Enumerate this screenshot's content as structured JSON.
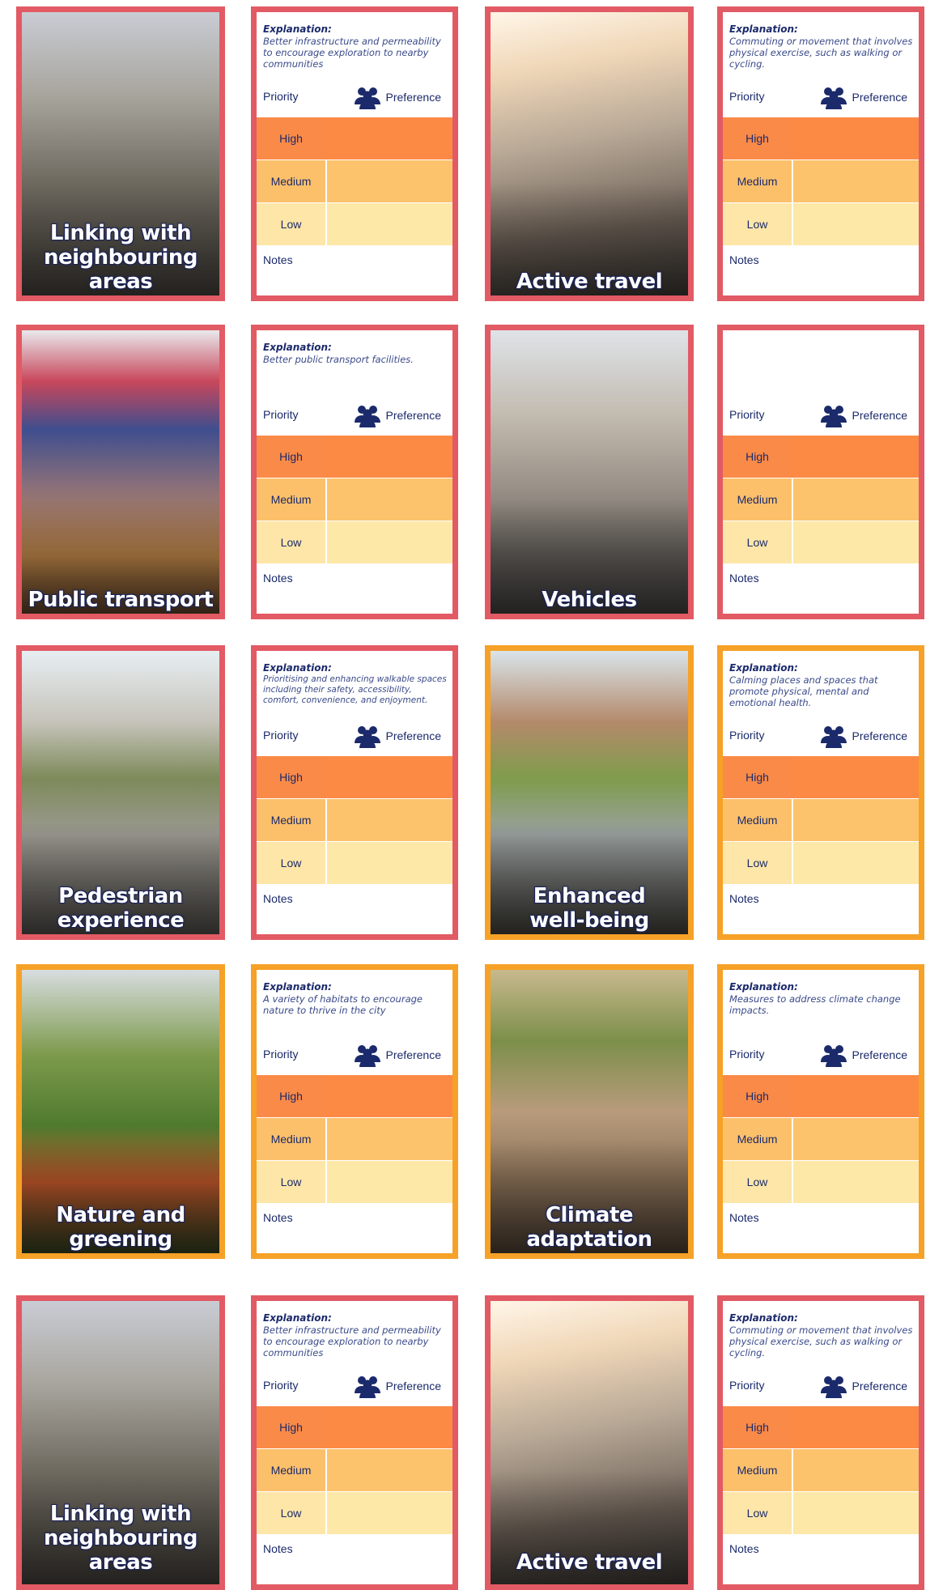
{
  "common": {
    "explanation_label": "Explanation:",
    "priority_label": "Priority",
    "preference_label": "Preference",
    "levels": {
      "high": "High",
      "medium": "Medium",
      "low": "Low"
    },
    "notes_label": "Notes"
  },
  "colors": {
    "red_border": "#e25a64",
    "orange_border": "#f6a127",
    "high": "#fb8a45",
    "medium": "#fdc26c",
    "low": "#fde8a8",
    "navy": "#1b2a6b"
  },
  "photos": [
    {
      "title": "Linking with\nneighbouring areas"
    },
    {
      "title": "Active travel"
    },
    {
      "title": "Public transport"
    },
    {
      "title": "Vehicles"
    },
    {
      "title": "Pedestrian\nexperience"
    },
    {
      "title": "Enhanced\nwell-being"
    },
    {
      "title": "Nature and\ngreening"
    },
    {
      "title": "Climate\nadaptation"
    },
    {
      "title": "Linking with\nneighbouring areas"
    },
    {
      "title": "Active travel"
    }
  ],
  "explanations": [
    {
      "text": "Better infrastructure and permeability to encourage exploration to nearby communities"
    },
    {
      "text": "Commuting or movement that involves physical exercise, such as walking or cycling."
    },
    {
      "text": "Better public transport facilities."
    },
    {
      "text": ""
    },
    {
      "text": "Prioritising and enhancing walkable spaces including their safety, accessibility, comfort, convenience, and enjoyment."
    },
    {
      "text": "Calming places and spaces that promote physical, mental and emotional health."
    },
    {
      "text": "A variety of habitats to encourage nature to thrive in the city"
    },
    {
      "text": "Measures to address climate change impacts."
    },
    {
      "text": "Better infrastructure and permeability to encourage exploration to nearby communities"
    },
    {
      "text": "Commuting or movement that involves physical exercise, such as walking or cycling."
    }
  ]
}
